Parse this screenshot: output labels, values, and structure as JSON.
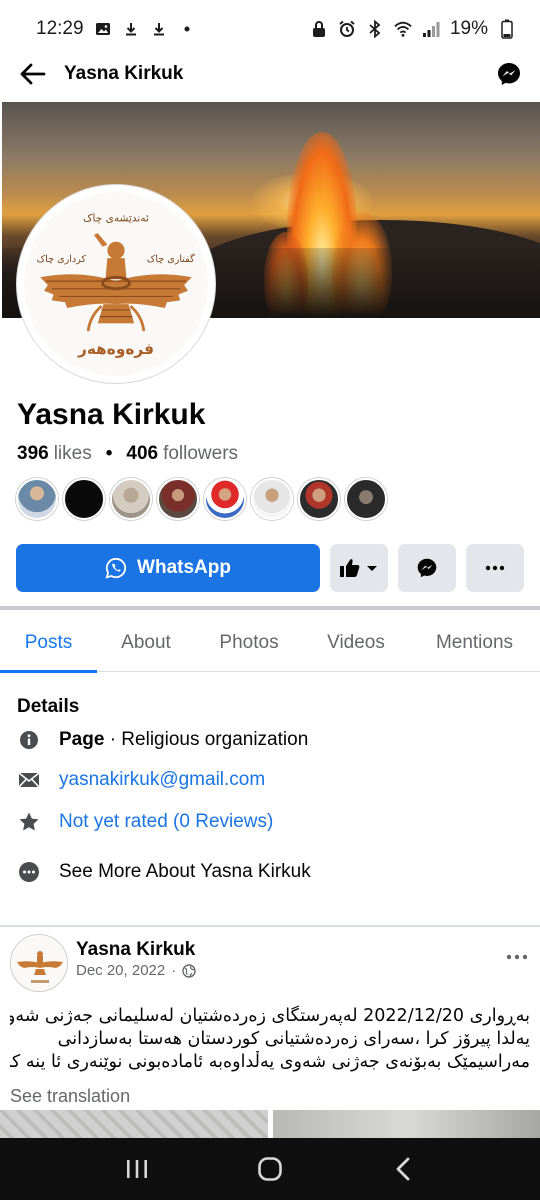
{
  "status_bar": {
    "time": "12:29",
    "battery": "19%",
    "left_icons": [
      "gallery-icon",
      "download-icon",
      "download-icon",
      "dot-icon"
    ],
    "right_icons": [
      "lock-icon",
      "alarm-icon",
      "bluetooth-icon",
      "wifi-icon",
      "signal-icon"
    ]
  },
  "header": {
    "title": "Yasna Kirkuk"
  },
  "logo": {
    "top_text": "ئەندێشەی چاک",
    "left_text": "کرداری چاک",
    "right_text": "گفتاری چاک",
    "bottom_text": "فرەوەهەر"
  },
  "page": {
    "name": "Yasna Kirkuk",
    "likes_count": "396",
    "likes_label": "likes",
    "followers_count": "406",
    "followers_label": "followers",
    "separator": "•"
  },
  "actions": {
    "whatsapp_label": "WhatsApp"
  },
  "tabs": [
    {
      "label": "Posts",
      "active": true
    },
    {
      "label": "About",
      "active": false
    },
    {
      "label": "Photos",
      "active": false
    },
    {
      "label": "Videos",
      "active": false
    },
    {
      "label": "Mentions",
      "active": false
    }
  ],
  "details": {
    "title": "Details",
    "category_bold": "Page",
    "category_rest": " · Religious organization",
    "email": "yasnakirkuk@gmail.com",
    "rating": "Not yet rated (0 Reviews)",
    "see_more": "See More About Yasna Kirkuk"
  },
  "post": {
    "author": "Yasna Kirkuk",
    "date": "Dec 20, 2022",
    "meta_separator": "·",
    "lines": [
      "بەڕواری 2022/12/20 لەپەرستگای زەردەشتیان لەسلیمانی جەژنی شەوی",
      "یەلدا پیرۆز کرا ،سەرای زەردەشتیانی کوردستان هەستا بەسازدانی",
      "مەراسیمێک بەبۆنەی جەژنی شەوی یەڵداوەبە ئامادەبونی نوێنەری ئا ینە کان ."
    ],
    "see_translation": "See translation"
  },
  "colors": {
    "accent": "#1b74e4",
    "secondary_text": "#65676b",
    "button_grey": "#e4e6eb",
    "nav_bar": "#0f0f0f"
  }
}
